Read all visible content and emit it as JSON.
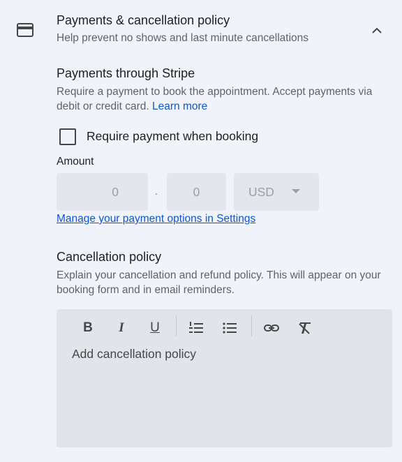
{
  "header": {
    "title": "Payments & cancellation policy",
    "subtitle": "Help prevent no shows and last minute cancellations"
  },
  "stripe": {
    "title": "Payments through Stripe",
    "description": "Require a payment to book the appointment. Accept payments via debit or credit card.",
    "learn_more": "Learn more"
  },
  "require_payment": {
    "label": "Require payment when booking",
    "checked": false
  },
  "amount": {
    "label": "Amount",
    "whole": "0",
    "separator": ".",
    "fraction": "0",
    "currency": "USD"
  },
  "manage_link": "Manage your payment options in Settings",
  "cancellation": {
    "title": "Cancellation policy",
    "description": "Explain your cancellation and refund policy. This will appear on your booking form and in email reminders.",
    "placeholder": "Add cancellation policy"
  },
  "toolbar": {
    "bold": "B",
    "italic": "I",
    "underline": "U"
  }
}
